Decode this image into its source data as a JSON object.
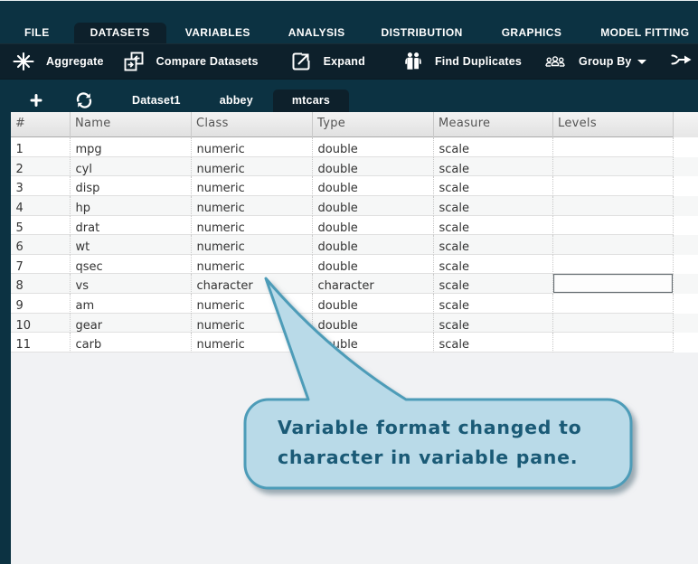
{
  "colors": {
    "navy": "#0c3242",
    "darknavy": "#0d202b",
    "canvas": "#f1f2f4",
    "callout_fill": "#b9dae8",
    "callout_border": "#4d9cb8",
    "callout_text": "#1a5a76"
  },
  "menubar": {
    "items": [
      {
        "label": "FILE",
        "active": false
      },
      {
        "label": "DATASETS",
        "active": true
      },
      {
        "label": "VARIABLES",
        "active": false
      },
      {
        "label": "ANALYSIS",
        "active": false
      },
      {
        "label": "DISTRIBUTION",
        "active": false
      },
      {
        "label": "GRAPHICS",
        "active": false
      },
      {
        "label": "MODEL FITTING",
        "active": false
      }
    ]
  },
  "toolbar": {
    "items": [
      {
        "icon": "aggregate-icon",
        "label": "Aggregate"
      },
      {
        "icon": "compare-datasets-icon",
        "label": "Compare Datasets"
      },
      {
        "icon": "expand-icon",
        "label": "Expand"
      },
      {
        "icon": "find-duplicates-icon",
        "label": "Find Duplicates"
      },
      {
        "icon": "group-by-icon",
        "label": "Group By",
        "caret": true
      }
    ],
    "right_icon": "goto-arrow-icon"
  },
  "tabstrip": {
    "icons": [
      "add-dataset-icon",
      "refresh-icon"
    ],
    "tabs": [
      {
        "label": "Dataset1",
        "active": false
      },
      {
        "label": "abbey",
        "active": false
      },
      {
        "label": "mtcars",
        "active": true
      }
    ]
  },
  "table": {
    "columns": [
      "#",
      "Name",
      "Class",
      "Type",
      "Measure",
      "Levels"
    ],
    "rows": [
      {
        "num": "1",
        "name": "mpg",
        "class": "numeric",
        "type": "double",
        "measure": "scale",
        "levels": ""
      },
      {
        "num": "2",
        "name": "cyl",
        "class": "numeric",
        "type": "double",
        "measure": "scale",
        "levels": ""
      },
      {
        "num": "3",
        "name": "disp",
        "class": "numeric",
        "type": "double",
        "measure": "scale",
        "levels": ""
      },
      {
        "num": "4",
        "name": "hp",
        "class": "numeric",
        "type": "double",
        "measure": "scale",
        "levels": ""
      },
      {
        "num": "5",
        "name": "drat",
        "class": "numeric",
        "type": "double",
        "measure": "scale",
        "levels": ""
      },
      {
        "num": "6",
        "name": "wt",
        "class": "numeric",
        "type": "double",
        "measure": "scale",
        "levels": ""
      },
      {
        "num": "7",
        "name": "qsec",
        "class": "numeric",
        "type": "double",
        "measure": "scale",
        "levels": ""
      },
      {
        "num": "8",
        "name": "vs",
        "class": "character",
        "type": "character",
        "measure": "scale",
        "levels": "",
        "focused": true
      },
      {
        "num": "9",
        "name": "am",
        "class": "numeric",
        "type": "double",
        "measure": "scale",
        "levels": ""
      },
      {
        "num": "10",
        "name": "gear",
        "class": "numeric",
        "type": "double",
        "measure": "scale",
        "levels": ""
      },
      {
        "num": "11",
        "name": "carb",
        "class": "numeric",
        "type": "double",
        "measure": "scale",
        "levels": ""
      }
    ]
  },
  "callout": {
    "line1": "Variable format changed to",
    "line2": "character in variable pane."
  }
}
